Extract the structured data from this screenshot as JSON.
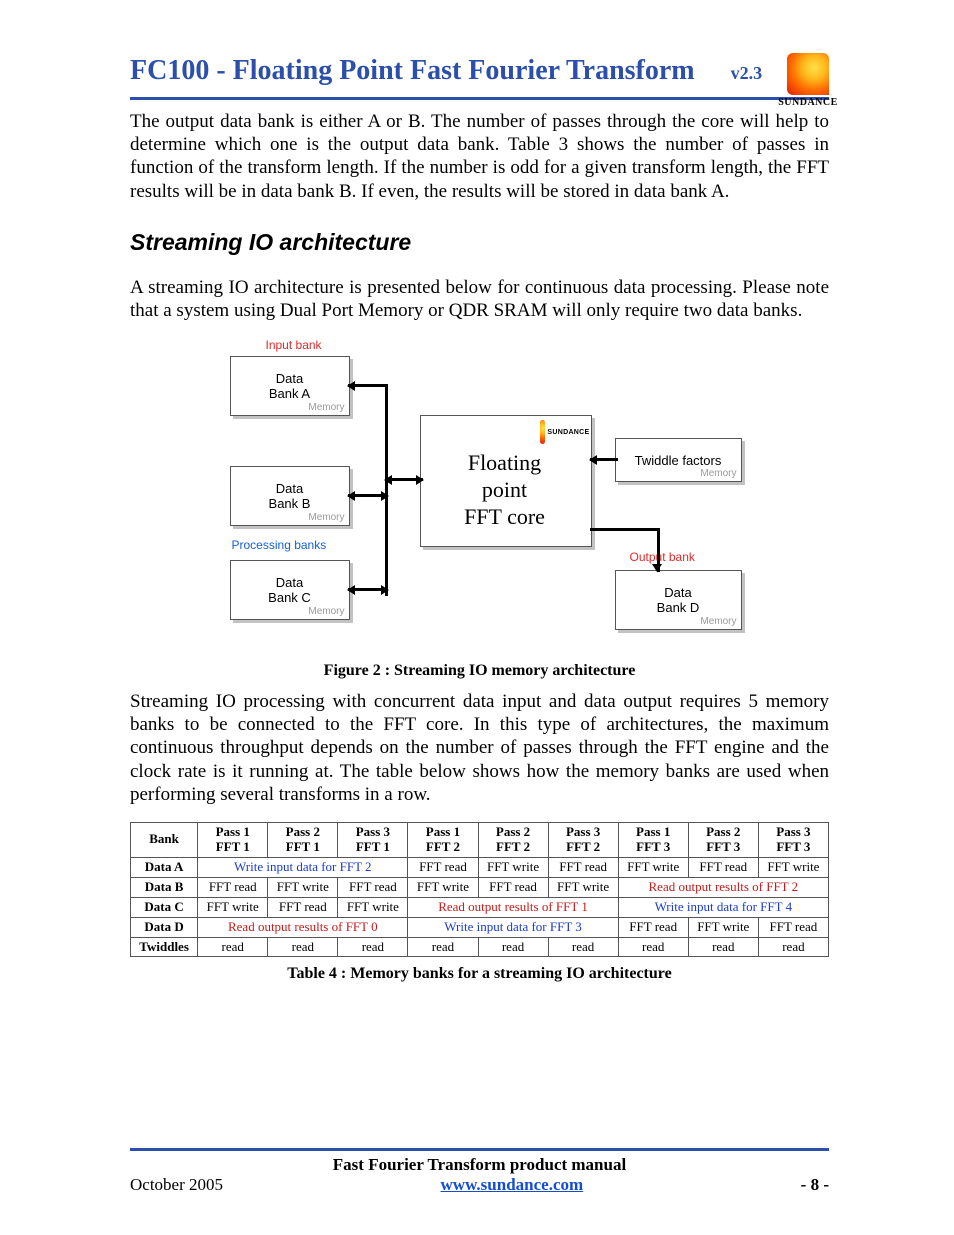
{
  "header": {
    "title": "FC100 - Floating Point Fast Fourier Transform",
    "version": "v2.3",
    "logo_text": "SUNDANCE"
  },
  "para1": "The output data bank is either A or B. The number of passes through the core will help to determine which one is the output data bank. Table 3 shows the number of passes in function of the transform length. If the number is odd for a given transform length, the FFT results will be in data bank B. If even, the results will be stored in data bank A.",
  "h2": "Streaming IO architecture",
  "para2": "A streaming IO architecture is presented below for continuous data processing. Please note that a system using Dual Port Memory or QDR SRAM will only require two data banks.",
  "diagram": {
    "input_bank_label": "Input bank",
    "processing_label": "Processing banks",
    "output_label": "Output bank",
    "bank_a": "Data\nBank A",
    "bank_b": "Data\nBank B",
    "bank_c": "Data\nBank C",
    "bank_d": "Data\nBank D",
    "twiddle": "Twiddle factors",
    "core_line1": "Floating",
    "core_line2": "point",
    "core_line3": "FFT core",
    "memory": "Memory",
    "core_logo": "SUNDANCE"
  },
  "figure2_caption": "Figure 2 : Streaming IO memory architecture",
  "para3": "Streaming IO processing with concurrent data input and data output requires 5 memory banks to be connected to the FFT core. In this type of architectures, the maximum continuous throughput depends on the number of passes through the FFT engine and the clock rate is it running at. The table below shows how the memory banks are used when performing several transforms in a row.",
  "table": {
    "headers": {
      "bank": "Bank",
      "p1f1": "Pass 1\nFFT 1",
      "p2f1": "Pass 2\nFFT 1",
      "p3f1": "Pass 3\nFFT 1",
      "p1f2": "Pass 1\nFFT 2",
      "p2f2": "Pass 2\nFFT 2",
      "p3f2": "Pass 3\nFFT 2",
      "p1f3": "Pass 1\nFFT 3",
      "p2f3": "Pass 2\nFFT 3",
      "p3f3": "Pass 3\nFFT 3"
    },
    "rows": {
      "dataA": {
        "label": "Data A",
        "g1": "Write input data for FFT 2",
        "c": [
          "FFT read",
          "FFT write",
          "FFT read",
          "FFT write",
          "FFT read",
          "FFT write"
        ]
      },
      "dataB": {
        "label": "Data B",
        "c": [
          "FFT read",
          "FFT write",
          "FFT read",
          "FFT write",
          "FFT read",
          "FFT write"
        ],
        "g3": "Read output results of FFT 2"
      },
      "dataC": {
        "label": "Data C",
        "c": [
          "FFT write",
          "FFT read",
          "FFT write"
        ],
        "g2": "Read output results of FFT 1",
        "g3": "Write input data for FFT 4"
      },
      "dataD": {
        "label": "Data D",
        "g1": "Read output results of FFT 0",
        "g2": "Write input data for FFT 3",
        "c": [
          "FFT read",
          "FFT write",
          "FFT read"
        ]
      },
      "twiddles": {
        "label": "Twiddles",
        "c": [
          "read",
          "read",
          "read",
          "read",
          "read",
          "read",
          "read",
          "read",
          "read"
        ]
      }
    }
  },
  "table4_caption": "Table 4 : Memory banks for a streaming IO architecture",
  "footer": {
    "line1": "Fast Fourier Transform product manual",
    "date": "October 2005",
    "link": "www.sundance.com",
    "page": "- 8 -"
  }
}
